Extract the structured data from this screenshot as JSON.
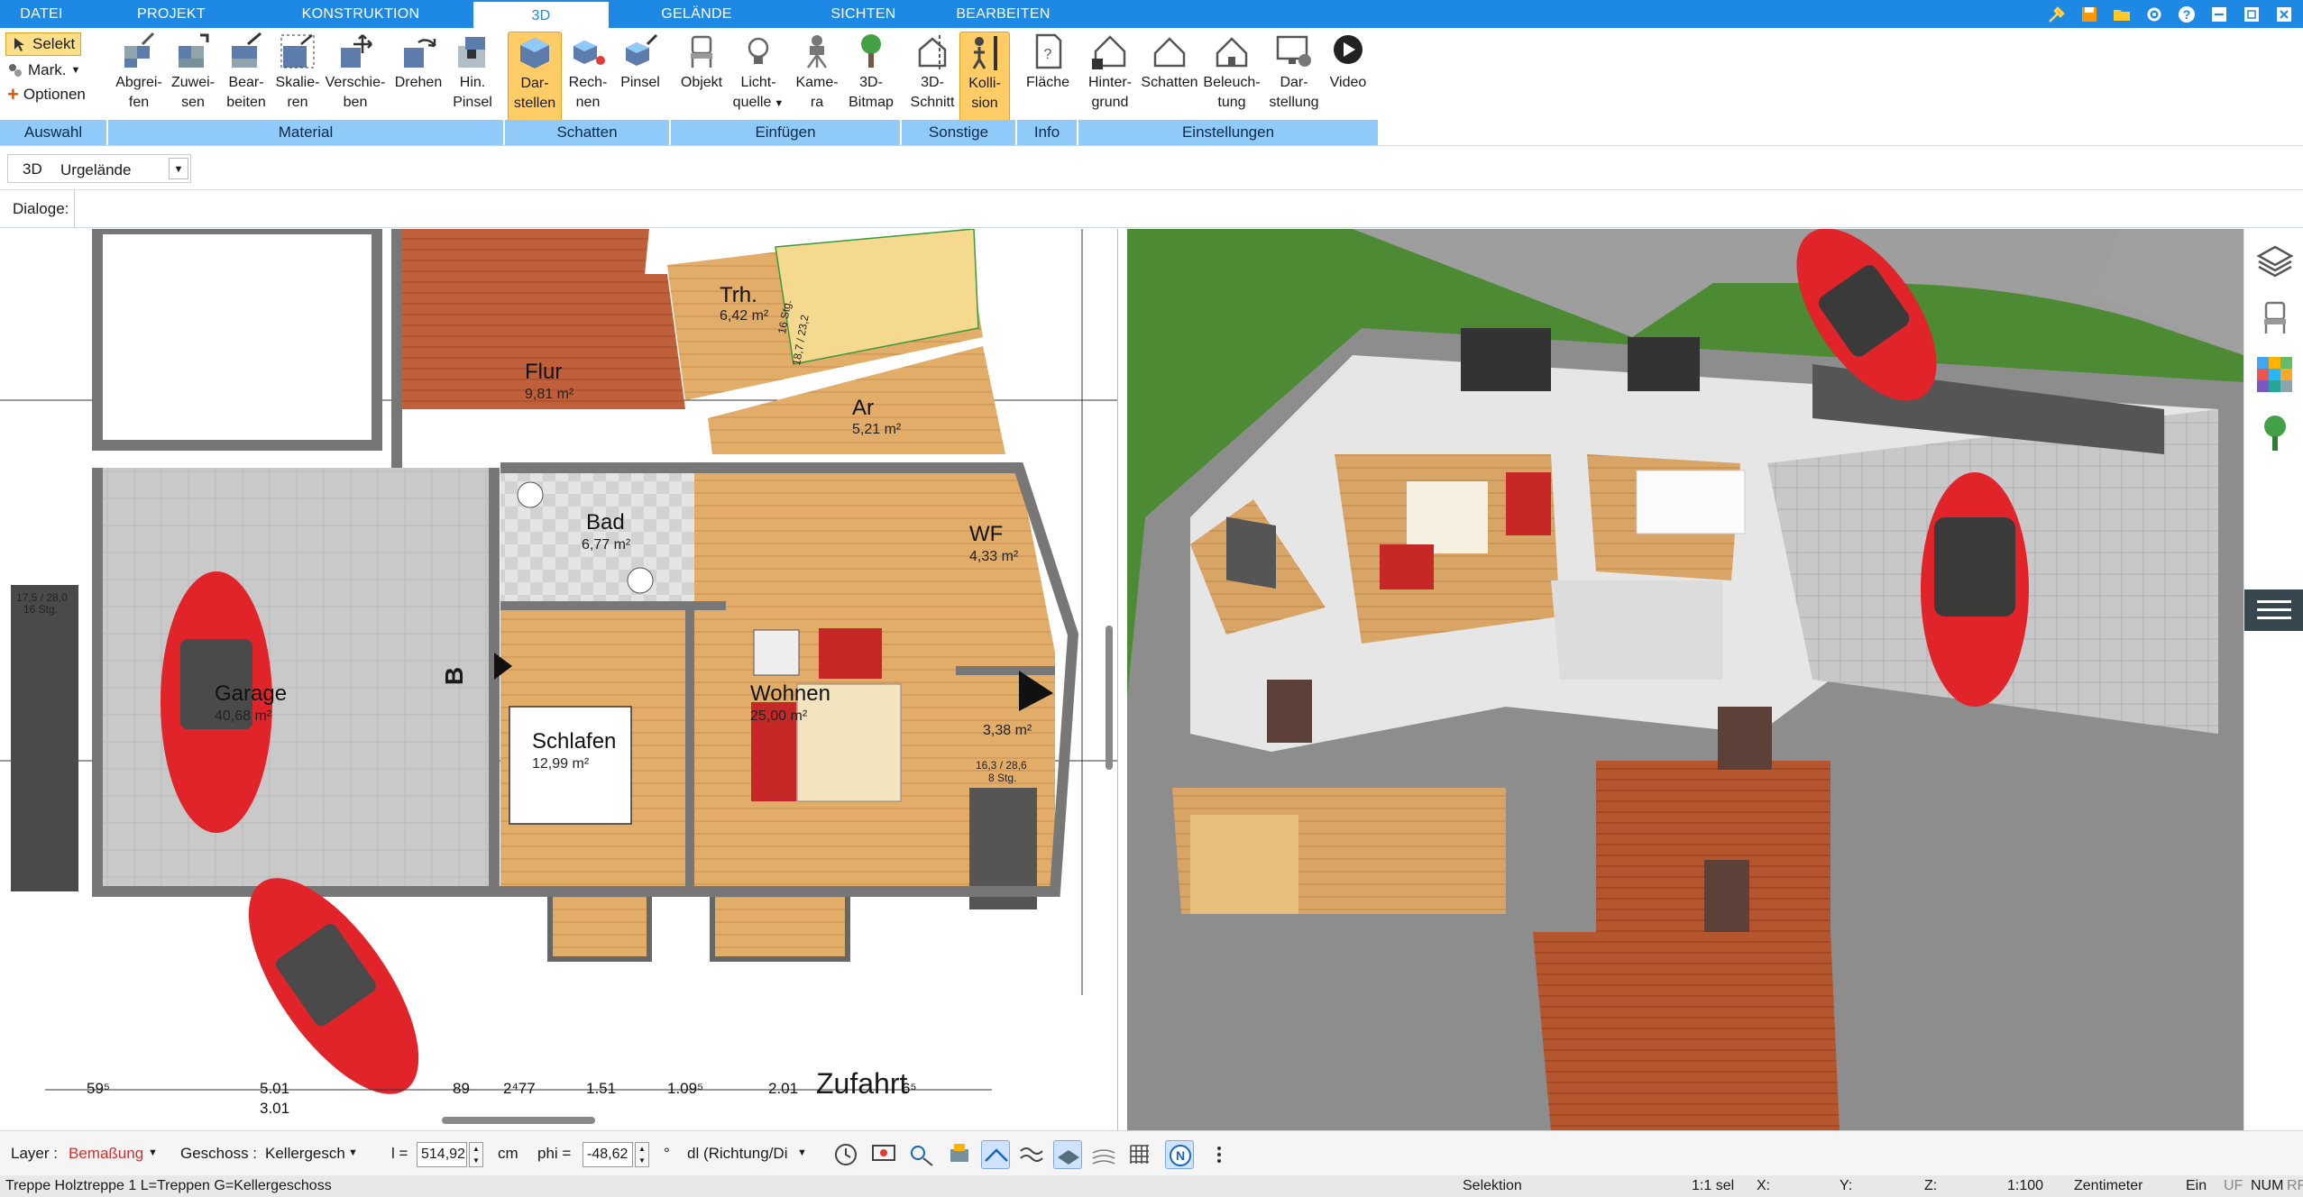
{
  "tabs": [
    "DATEI",
    "PROJEKT",
    "KONSTRUKTION",
    "3D",
    "GELÄNDE",
    "SICHTEN",
    "BEARBEITEN"
  ],
  "auswahl": {
    "selekt": "Selekt",
    "mark": "Mark.",
    "optionen": "Optionen",
    "group": "Auswahl"
  },
  "ribbon": {
    "material": {
      "group": "Material",
      "buttons": [
        {
          "l1": "Abgrei-",
          "l2": "fen"
        },
        {
          "l1": "Zuwei-",
          "l2": "sen"
        },
        {
          "l1": "Bear-",
          "l2": "beiten"
        },
        {
          "l1": "Skalie-",
          "l2": "ren"
        },
        {
          "l1": "Verschie-",
          "l2": "ben"
        },
        {
          "l1": "Drehen",
          "l2": ""
        },
        {
          "l1": "Hin.",
          "l2": "Pinsel"
        }
      ]
    },
    "schatten": {
      "group": "Schatten",
      "buttons": [
        {
          "l1": "Dar-",
          "l2": "stellen"
        },
        {
          "l1": "Rech-",
          "l2": "nen"
        },
        {
          "l1": "Pinsel",
          "l2": ""
        }
      ]
    },
    "einfuegen": {
      "group": "Einfügen",
      "buttons": [
        {
          "l1": "Objekt",
          "l2": ""
        },
        {
          "l1": "Licht-",
          "l2": "quelle"
        },
        {
          "l1": "Kame-",
          "l2": "ra"
        },
        {
          "l1": "3D-",
          "l2": "Bitmap"
        }
      ]
    },
    "sonstige": {
      "group": "Sonstige",
      "buttons": [
        {
          "l1": "3D-",
          "l2": "Schnitt"
        },
        {
          "l1": "Kolli-",
          "l2": "sion"
        }
      ]
    },
    "info": {
      "group": "Info",
      "buttons": [
        {
          "l1": "Fläche",
          "l2": ""
        }
      ]
    },
    "einstellungen": {
      "group": "Einstellungen",
      "buttons": [
        {
          "l1": "Hinter-",
          "l2": "grund"
        },
        {
          "l1": "Schatten",
          "l2": ""
        },
        {
          "l1": "Beleuch-",
          "l2": "tung"
        },
        {
          "l1": "Dar-",
          "l2": "stellung"
        },
        {
          "l1": "Video",
          "l2": ""
        }
      ]
    }
  },
  "row2": {
    "mode": "3D",
    "terrain": "Urgelände"
  },
  "row3": {
    "label": "Dialoge:"
  },
  "plan": {
    "rooms": [
      {
        "name": "Flur",
        "area": "9,81 m²"
      },
      {
        "name": "Trh.",
        "area": "6,42 m²"
      },
      {
        "name": "Ar",
        "area": "5,21 m²"
      },
      {
        "name": "Bad",
        "area": "6,77 m²"
      },
      {
        "name": "WF",
        "area": "4,33 m²"
      },
      {
        "name": "Garage",
        "area": "40,68 m²"
      },
      {
        "name": "Wohnen",
        "area": "25,00 m²"
      },
      {
        "name": "Schlafen",
        "area": "12,99 m²"
      },
      {
        "name": "",
        "area": "3,38 m²"
      }
    ],
    "stair_labels": [
      "16 Stg.",
      "18,7 / 23,2",
      "17,5 / 28,0",
      "16 Stg.",
      "16,3 / 28,6",
      "8 Stg."
    ],
    "section_marker": "B",
    "zufahrt": "Zufahrt",
    "dims": [
      "59⁵",
      "5.01",
      "89",
      "2⁴77",
      "1.51",
      "1.09⁵",
      "2.01",
      "6⁵",
      "3.01"
    ]
  },
  "statusbar": {
    "layer_label": "Layer :",
    "layer_value": "Bemaßung",
    "geschoss_label": "Geschoss :",
    "geschoss_value": "Kellergesch",
    "l_label": "l =",
    "l_value": "514,92",
    "l_unit": "cm",
    "phi_label": "phi =",
    "phi_value": "-48,62",
    "phi_unit": "°",
    "dl_value": "dl (Richtung/Di"
  },
  "bottombar": {
    "info": "Treppe Holztreppe 1 L=Treppen G=Kellergeschoss",
    "mode": "Selektion",
    "scale_sel": "1:1 sel",
    "x": "X:",
    "y": "Y:",
    "z": "Z:",
    "scale": "1:100",
    "unit": "Zentimeter",
    "ein": "Ein",
    "uf": "UF",
    "num": "NUM",
    "rf": "RF"
  },
  "colors": {
    "accent": "#1e88e5",
    "group_bar": "#90caf9",
    "active_button": "#ffcc66",
    "wood": "#d9a566",
    "terracotta": "#b5562e",
    "grass": "#4c8a33",
    "car": "#e0242a"
  }
}
